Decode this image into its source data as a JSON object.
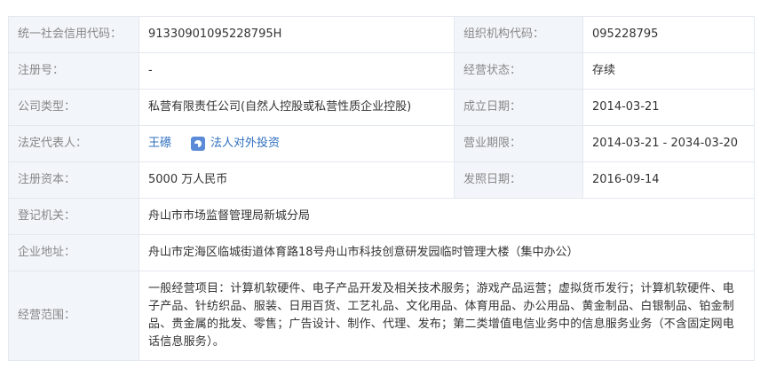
{
  "rows": [
    {
      "label": "统一社会信用代码：",
      "value": "91330901095228795H",
      "label2": "组织机构代码：",
      "value2": "095228795"
    },
    {
      "label": "注册号：",
      "value": "-",
      "label2": "经营状态：",
      "value2": "存续"
    },
    {
      "label": "公司类型：",
      "value": "私营有限责任公司(自然人控股或私营性质企业控股)",
      "label2": "成立日期：",
      "value2": "2014-03-21"
    },
    {
      "label": "法定代表人：",
      "rep_name": "王礤",
      "rep_link": "法人对外投资",
      "label2": "营业期限：",
      "value2": "2014-03-21 - 2034-03-20"
    },
    {
      "label": "注册资本：",
      "value": "5000 万人民币",
      "label2": "发照日期：",
      "value2": "2016-09-14"
    },
    {
      "label": "登记机关：",
      "value": "舟山市市场监督管理局新城分局"
    },
    {
      "label": "企业地址：",
      "value": "舟山市定海区临城街道体育路18号舟山市科技创意研发园临时管理大楼（集中办公）"
    },
    {
      "label": "经营范围：",
      "value": "一般经营项目：计算机软硬件、电子产品开发及相关技术服务；游戏产品运营；虚拟货币发行；计算机软硬件、电子产品、针纺织品、服装、日用百货、工艺礼品、文化用品、体育用品、办公用品、黄金制品、白银制品、铂金制品、贵金属的批发、零售；广告设计、制作、代理、发布；第二类增值电信业务中的信息服务业务（不含固定网电话信息服务）。"
    }
  ],
  "colors": {
    "label_bg": "#f2f5fa",
    "border": "#e4e8ef",
    "link": "#2f6fbf",
    "icon": "#5b8bd8"
  }
}
